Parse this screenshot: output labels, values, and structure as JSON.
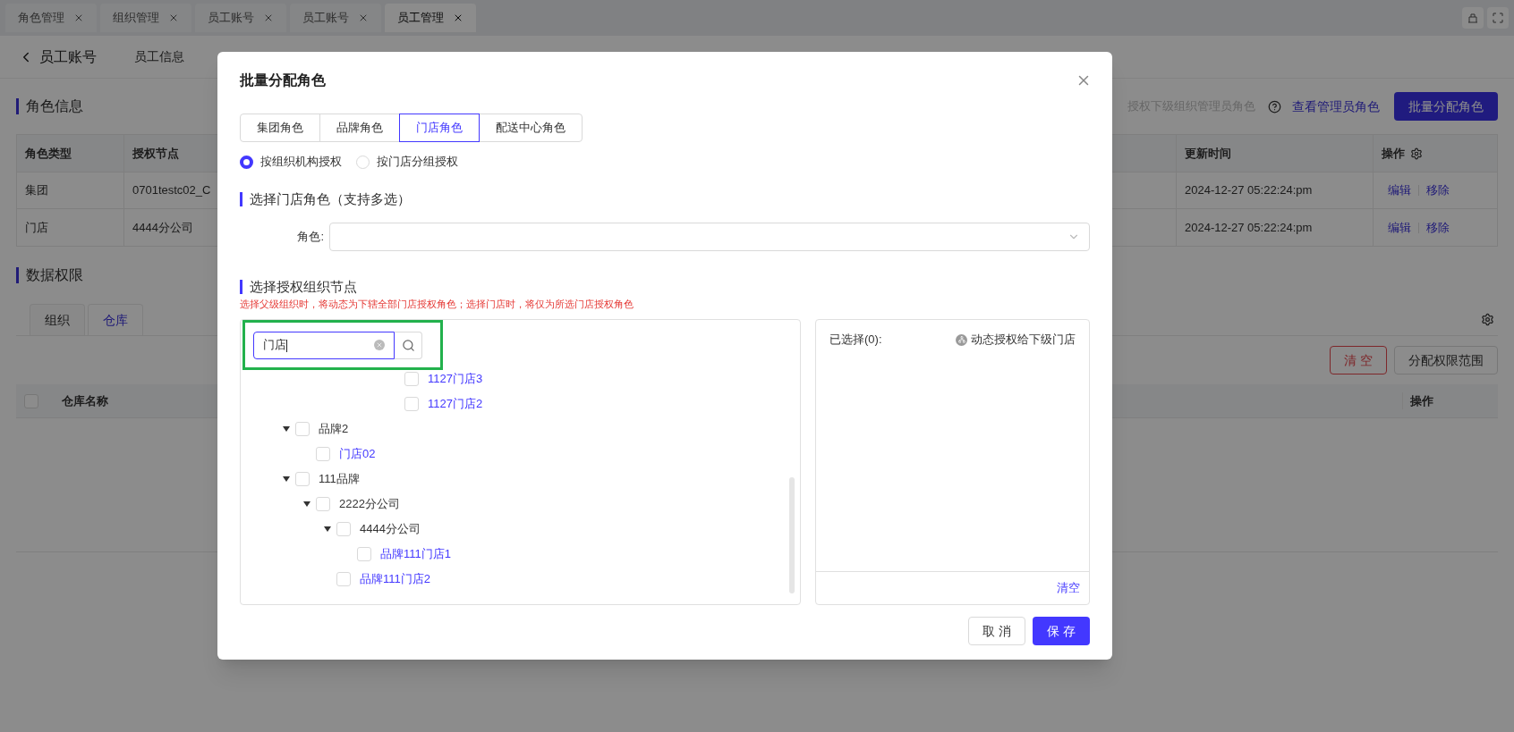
{
  "top_tabs": [
    {
      "label": "角色管理",
      "selected": false
    },
    {
      "label": "组织管理",
      "selected": false
    },
    {
      "label": "员工账号",
      "selected": false
    },
    {
      "label": "员工账号",
      "selected": false
    },
    {
      "label": "员工管理",
      "selected": true
    }
  ],
  "page": {
    "back_label": "员工账号",
    "tabs": [
      {
        "label": "员工信息",
        "selected": false
      }
    ]
  },
  "role_section": {
    "title": "角色信息",
    "hint": "授权下级组织管理员角色",
    "link": "查看管理员角色",
    "button": "批量分配角色",
    "columns": [
      "角色类型",
      "授权节点",
      "更新时间",
      "操作"
    ],
    "rows": [
      {
        "type": "集团",
        "node": "0701testc02_C",
        "updated": "2024-12-27 05:22:24:pm",
        "actions": [
          "编辑",
          "移除"
        ]
      },
      {
        "type": "门店",
        "node": "4444分公司",
        "updated": "2024-12-27 05:22:24:pm",
        "actions": [
          "编辑",
          "移除"
        ]
      }
    ]
  },
  "data_section": {
    "title": "数据权限",
    "tabs": [
      {
        "label": "组织",
        "selected": false
      },
      {
        "label": "仓库",
        "selected": true
      }
    ],
    "buttons": [
      {
        "label": "清 空",
        "kind": "danger"
      },
      {
        "label": "分配权限范围",
        "kind": "default"
      }
    ],
    "select_all_checked": false,
    "columns": [
      "仓库名称",
      "操作"
    ]
  },
  "modal": {
    "title": "批量分配角色",
    "role_tabs": [
      {
        "label": "集团角色",
        "selected": false
      },
      {
        "label": "品牌角色",
        "selected": false
      },
      {
        "label": "门店角色",
        "selected": true
      },
      {
        "label": "配送中心角色",
        "selected": false
      }
    ],
    "modes": [
      {
        "label": "按组织机构授权",
        "selected": true
      },
      {
        "label": "按门店分组授权",
        "selected": false
      }
    ],
    "role_heading": "选择门店角色（支持多选）",
    "role_label": "角色:",
    "node_heading": "选择授权组织节点",
    "node_hint": "选择父级组织时，将动态为下辖全部门店授权角色；选择门店时，将仅为所选门店授权角色",
    "search_value": "门店",
    "continued_items": [
      {
        "label": "1127门店3",
        "kind": "store",
        "checked": false
      },
      {
        "label": "1127门店2",
        "kind": "store",
        "checked": false
      }
    ],
    "tree": [
      {
        "label": "品牌2",
        "kind": "org",
        "checked": false,
        "expanded": true,
        "children": [
          {
            "label": "门店02",
            "kind": "store",
            "checked": false
          }
        ]
      },
      {
        "label": "111品牌",
        "kind": "org",
        "checked": false,
        "expanded": true,
        "children": [
          {
            "label": "2222分公司",
            "kind": "org",
            "checked": false,
            "expanded": true,
            "children": [
              {
                "label": "4444分公司",
                "kind": "org",
                "checked": false,
                "expanded": true,
                "children": [
                  {
                    "label": "品牌111门店1",
                    "kind": "store",
                    "checked": false
                  }
                ]
              },
              {
                "label": "品牌111门店2",
                "kind": "store",
                "checked": false
              }
            ]
          }
        ]
      }
    ],
    "selected_label": "已选择(0):",
    "dynamic_label": "动态授权给下级门店",
    "clear_link": "清空",
    "cancel": "取 消",
    "save": "保 存"
  }
}
